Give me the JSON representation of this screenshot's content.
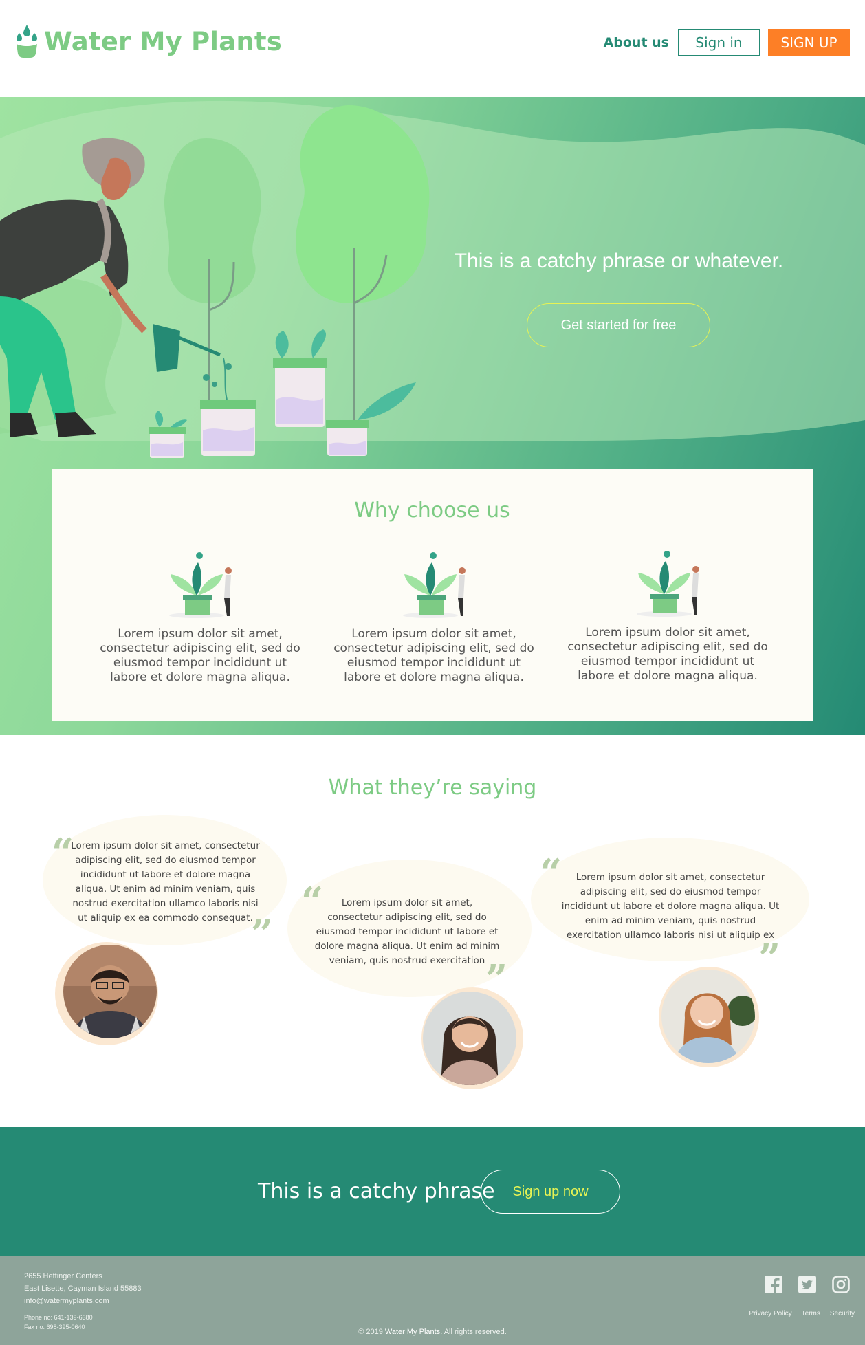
{
  "header": {
    "brand": "Water My Plants",
    "nav": {
      "about": "About us",
      "signin": "Sign in",
      "signup": "SIGN UP"
    }
  },
  "hero": {
    "title": "This is a catchy phrase or whatever.",
    "cta": "Get started for free"
  },
  "why": {
    "title": "Why choose us",
    "features": [
      {
        "text": "Lorem ipsum dolor sit amet, consectetur adipiscing elit, sed do eiusmod tempor incididunt ut labore et dolore magna aliqua."
      },
      {
        "text": "Lorem ipsum dolor sit amet, consectetur adipiscing elit, sed do eiusmod tempor incididunt ut labore et dolore magna aliqua."
      },
      {
        "text": "Lorem ipsum dolor sit amet, consectetur adipiscing elit, sed do eiusmod tempor incididunt ut labore et dolore magna aliqua."
      }
    ]
  },
  "testimonials": {
    "title": "What they’re saying",
    "quote_open": "“",
    "quote_close": "”",
    "items": [
      {
        "text": "Lorem ipsum dolor sit amet, consectetur adipiscing elit, sed do eiusmod tempor incididunt ut labore et dolore magna aliqua. Ut enim ad minim veniam, quis nostrud exercitation ullamco laboris nisi ut aliquip ex ea commodo consequat."
      },
      {
        "text": "Lorem ipsum dolor sit amet, consectetur adipiscing elit, sed do eiusmod tempor incididunt ut labore et dolore magna aliqua. Ut enim ad minim veniam, quis nostrud exercitation ullamco laboris nisi ut aliquip"
      },
      {
        "text": "Lorem ipsum dolor sit amet, consectetur adipiscing elit, sed do eiusmod tempor incididunt ut labore et dolore magna aliqua. Ut enim ad minim veniam, quis nostrud exercitation ullamco laboris nisi ut aliquip ex ea commodo consequat."
      }
    ]
  },
  "cta_band": {
    "text": "This is a catchy phrase",
    "button": "Sign up now"
  },
  "footer": {
    "address_line1": "2655 Hettinger Centers",
    "address_line2": "East Lisette, Cayman Island 55883",
    "email": "info@watermyplants.com",
    "phone": "Phone no: 641-139-6380",
    "fax": "Fax no: 698-395-0640",
    "links": [
      "Privacy Policy",
      "Terms",
      "Security"
    ],
    "copyright_prefix": "© 2019",
    "copyright_brand": "Water My Plants",
    "copyright_suffix": ". All rights reserved.",
    "social_icons": [
      "facebook-icon",
      "twitter-icon",
      "instagram-icon"
    ]
  },
  "colors": {
    "brand_green": "#7dcb84",
    "dark_teal": "#258a74",
    "signup_orange": "#fd7f26",
    "cta_yellow": "#e7f354",
    "footer_grey": "#8ea49a"
  }
}
